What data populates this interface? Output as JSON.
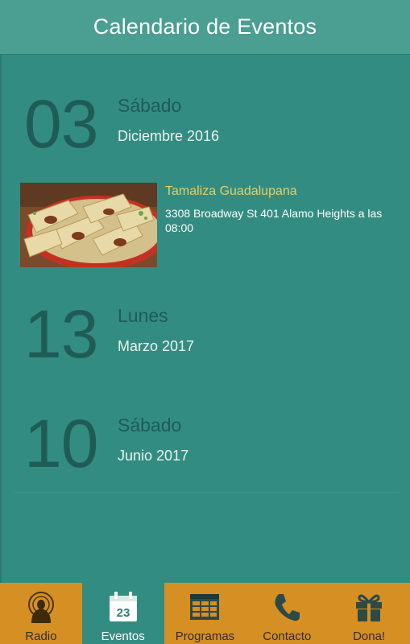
{
  "header": {
    "title": "Calendario de Eventos"
  },
  "events_list": [
    {
      "day": "03",
      "weekday": "Sábado",
      "month_year": "Diciembre 2016"
    },
    {
      "day": "13",
      "weekday": "Lunes",
      "month_year": "Marzo 2017"
    },
    {
      "day": "10",
      "weekday": "Sábado",
      "month_year": "Junio 2017"
    }
  ],
  "event": {
    "title": "Tamaliza Guadalupana",
    "detail": "3308 Broadway St 401 Alamo Heights a las 08:00",
    "image_icon": "tamales-photo"
  },
  "tabbar": {
    "tabs": [
      {
        "label": "Radio",
        "icon": "radio-virgin-icon"
      },
      {
        "label": "Eventos",
        "icon": "calendar-icon",
        "icon_text": "23",
        "active": true
      },
      {
        "label": "Programas",
        "icon": "schedule-grid-icon"
      },
      {
        "label": "Contacto",
        "icon": "phone-icon"
      },
      {
        "label": "Dona!",
        "icon": "gift-icon"
      }
    ]
  },
  "colors": {
    "background": "#338c82",
    "header": "#4a9e92",
    "tabbar": "#d68f22",
    "event_title": "#e7cf63",
    "day_number": "#1f5c57"
  }
}
